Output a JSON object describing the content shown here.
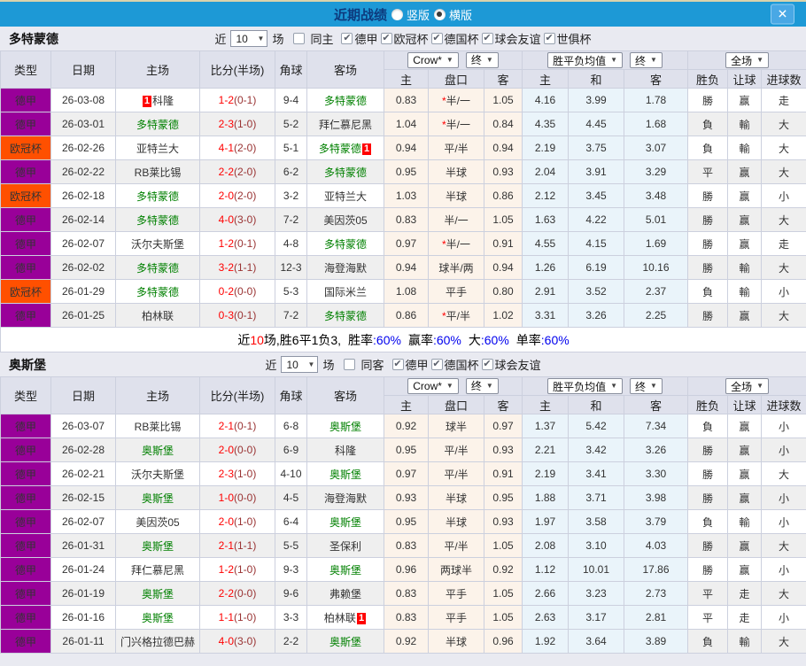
{
  "titlebar": {
    "title": "近期战绩",
    "options": [
      {
        "label": "竖版",
        "selected": false
      },
      {
        "label": "横版",
        "selected": true
      }
    ],
    "close_label": "✕"
  },
  "table_columns": {
    "main": [
      "类型",
      "日期",
      "主场",
      "比分(半场)",
      "角球",
      "客场"
    ],
    "group1_select": "Crow*",
    "group1_final": "终",
    "group2_select": "胜平负均值",
    "group2_final": "终",
    "group3_select": "全场",
    "sub": [
      "主",
      "盘口",
      "客",
      "主",
      "和",
      "客",
      "胜负",
      "让球",
      "进球数"
    ],
    "caret": "▼"
  },
  "colors": {
    "purple": "#990099",
    "orange": "#ff5000",
    "focus_green": "#008000",
    "win_red": "#ff0000",
    "loss_green": "#008000",
    "push_blue": "#0000ee",
    "half_score": "#993333",
    "percent_blue": "#0000ee",
    "titlebar_blue": "#1d99d6"
  },
  "sections": [
    {
      "team": "多特蒙德",
      "filters": {
        "near": "近",
        "count": "10",
        "unit": "场",
        "same": {
          "label": "同主",
          "checked": false
        },
        "leagues": [
          {
            "label": "德甲",
            "checked": true
          },
          {
            "label": "欧冠杯",
            "checked": true
          },
          {
            "label": "德国杯",
            "checked": true
          },
          {
            "label": "球会友谊",
            "checked": true
          },
          {
            "label": "世俱杯",
            "checked": true
          }
        ]
      },
      "rows": [
        {
          "league": "德甲",
          "color": "purple",
          "date": "26-03-08",
          "home": "科隆",
          "home_focus": false,
          "home_badge": true,
          "score": "1-2",
          "half": "(0-1)",
          "corners": "9-4",
          "away": "多特蒙德",
          "away_focus": true,
          "away_badge": false,
          "h_home": "0.83",
          "h_star": true,
          "h_line": "半/一",
          "h_away": "1.05",
          "avg_home": "4.16",
          "avg_draw": "3.99",
          "avg_away": "1.78",
          "r_outcome": "勝",
          "r_handicap": "赢",
          "r_goals": "走"
        },
        {
          "league": "德甲",
          "color": "purple",
          "date": "26-03-01",
          "home": "多特蒙德",
          "home_focus": true,
          "home_badge": false,
          "score": "2-3",
          "half": "(1-0)",
          "corners": "5-2",
          "away": "拜仁慕尼黑",
          "away_focus": false,
          "away_badge": false,
          "h_home": "1.04",
          "h_star": true,
          "h_line": "半/一",
          "h_away": "0.84",
          "avg_home": "4.35",
          "avg_draw": "4.45",
          "avg_away": "1.68",
          "r_outcome": "負",
          "r_handicap": "輸",
          "r_goals": "大"
        },
        {
          "league": "欧冠杯",
          "color": "orange",
          "date": "26-02-26",
          "home": "亚特兰大",
          "home_focus": false,
          "home_badge": false,
          "score": "4-1",
          "half": "(2-0)",
          "corners": "5-1",
          "away": "多特蒙德",
          "away_focus": true,
          "away_badge": true,
          "h_home": "0.94",
          "h_star": false,
          "h_line": "平/半",
          "h_away": "0.94",
          "avg_home": "2.19",
          "avg_draw": "3.75",
          "avg_away": "3.07",
          "r_outcome": "負",
          "r_handicap": "輸",
          "r_goals": "大"
        },
        {
          "league": "德甲",
          "color": "purple",
          "date": "26-02-22",
          "home": "RB莱比锡",
          "home_focus": false,
          "home_badge": false,
          "score": "2-2",
          "half": "(2-0)",
          "corners": "6-2",
          "away": "多特蒙德",
          "away_focus": true,
          "away_badge": false,
          "h_home": "0.95",
          "h_star": false,
          "h_line": "半球",
          "h_away": "0.93",
          "avg_home": "2.04",
          "avg_draw": "3.91",
          "avg_away": "3.29",
          "r_outcome": "平",
          "r_handicap": "赢",
          "r_goals": "大"
        },
        {
          "league": "欧冠杯",
          "color": "orange",
          "date": "26-02-18",
          "home": "多特蒙德",
          "home_focus": true,
          "home_badge": false,
          "score": "2-0",
          "half": "(2-0)",
          "corners": "3-2",
          "away": "亚特兰大",
          "away_focus": false,
          "away_badge": false,
          "h_home": "1.03",
          "h_star": false,
          "h_line": "半球",
          "h_away": "0.86",
          "avg_home": "2.12",
          "avg_draw": "3.45",
          "avg_away": "3.48",
          "r_outcome": "勝",
          "r_handicap": "赢",
          "r_goals": "小"
        },
        {
          "league": "德甲",
          "color": "purple",
          "date": "26-02-14",
          "home": "多特蒙德",
          "home_focus": true,
          "home_badge": false,
          "score": "4-0",
          "half": "(3-0)",
          "corners": "7-2",
          "away": "美因茨05",
          "away_focus": false,
          "away_badge": false,
          "h_home": "0.83",
          "h_star": false,
          "h_line": "半/一",
          "h_away": "1.05",
          "avg_home": "1.63",
          "avg_draw": "4.22",
          "avg_away": "5.01",
          "r_outcome": "勝",
          "r_handicap": "赢",
          "r_goals": "大"
        },
        {
          "league": "德甲",
          "color": "purple",
          "date": "26-02-07",
          "home": "沃尔夫斯堡",
          "home_focus": false,
          "home_badge": false,
          "score": "1-2",
          "half": "(0-1)",
          "corners": "4-8",
          "away": "多特蒙德",
          "away_focus": true,
          "away_badge": false,
          "h_home": "0.97",
          "h_star": true,
          "h_line": "半/一",
          "h_away": "0.91",
          "avg_home": "4.55",
          "avg_draw": "4.15",
          "avg_away": "1.69",
          "r_outcome": "勝",
          "r_handicap": "赢",
          "r_goals": "走"
        },
        {
          "league": "德甲",
          "color": "purple",
          "date": "26-02-02",
          "home": "多特蒙德",
          "home_focus": true,
          "home_badge": false,
          "score": "3-2",
          "half": "(1-1)",
          "corners": "12-3",
          "away": "海登海默",
          "away_focus": false,
          "away_badge": false,
          "h_home": "0.94",
          "h_star": false,
          "h_line": "球半/两",
          "h_away": "0.94",
          "avg_home": "1.26",
          "avg_draw": "6.19",
          "avg_away": "10.16",
          "r_outcome": "勝",
          "r_handicap": "輸",
          "r_goals": "大"
        },
        {
          "league": "欧冠杯",
          "color": "orange",
          "date": "26-01-29",
          "home": "多特蒙德",
          "home_focus": true,
          "home_badge": false,
          "score": "0-2",
          "half": "(0-0)",
          "corners": "5-3",
          "away": "国际米兰",
          "away_focus": false,
          "away_badge": false,
          "h_home": "1.08",
          "h_star": false,
          "h_line": "平手",
          "h_away": "0.80",
          "avg_home": "2.91",
          "avg_draw": "3.52",
          "avg_away": "2.37",
          "r_outcome": "負",
          "r_handicap": "輸",
          "r_goals": "小"
        },
        {
          "league": "德甲",
          "color": "purple",
          "date": "26-01-25",
          "home": "柏林联",
          "home_focus": false,
          "home_badge": false,
          "score": "0-3",
          "half": "(0-1)",
          "corners": "7-2",
          "away": "多特蒙德",
          "away_focus": true,
          "away_badge": false,
          "h_home": "0.86",
          "h_star": true,
          "h_line": "平/半",
          "h_away": "1.02",
          "avg_home": "3.31",
          "avg_draw": "3.26",
          "avg_away": "2.25",
          "r_outcome": "勝",
          "r_handicap": "赢",
          "r_goals": "大"
        }
      ],
      "summary": {
        "pre": "近",
        "count": "10",
        "mid": "场,胜6平1负3,",
        "stats": [
          {
            "label": "胜率",
            "value": "60%"
          },
          {
            "label": "赢率",
            "value": "60%"
          },
          {
            "label": "大",
            "value": "60%"
          },
          {
            "label": "单率",
            "value": "60%"
          }
        ]
      }
    },
    {
      "team": "奥斯堡",
      "filters": {
        "near": "近",
        "count": "10",
        "unit": "场",
        "same": {
          "label": "同客",
          "checked": false
        },
        "leagues": [
          {
            "label": "德甲",
            "checked": true
          },
          {
            "label": "德国杯",
            "checked": true
          },
          {
            "label": "球会友谊",
            "checked": true
          }
        ]
      },
      "rows": [
        {
          "league": "德甲",
          "color": "purple",
          "date": "26-03-07",
          "home": "RB莱比锡",
          "home_focus": false,
          "home_badge": false,
          "score": "2-1",
          "half": "(0-1)",
          "corners": "6-8",
          "away": "奥斯堡",
          "away_focus": true,
          "away_badge": false,
          "h_home": "0.92",
          "h_star": false,
          "h_line": "球半",
          "h_away": "0.97",
          "avg_home": "1.37",
          "avg_draw": "5.42",
          "avg_away": "7.34",
          "r_outcome": "負",
          "r_handicap": "赢",
          "r_goals": "小"
        },
        {
          "league": "德甲",
          "color": "purple",
          "date": "26-02-28",
          "home": "奥斯堡",
          "home_focus": true,
          "home_badge": false,
          "score": "2-0",
          "half": "(0-0)",
          "corners": "6-9",
          "away": "科隆",
          "away_focus": false,
          "away_badge": false,
          "h_home": "0.95",
          "h_star": false,
          "h_line": "平/半",
          "h_away": "0.93",
          "avg_home": "2.21",
          "avg_draw": "3.42",
          "avg_away": "3.26",
          "r_outcome": "勝",
          "r_handicap": "赢",
          "r_goals": "小"
        },
        {
          "league": "德甲",
          "color": "purple",
          "date": "26-02-21",
          "home": "沃尔夫斯堡",
          "home_focus": false,
          "home_badge": false,
          "score": "2-3",
          "half": "(1-0)",
          "corners": "4-10",
          "away": "奥斯堡",
          "away_focus": true,
          "away_badge": false,
          "h_home": "0.97",
          "h_star": false,
          "h_line": "平/半",
          "h_away": "0.91",
          "avg_home": "2.19",
          "avg_draw": "3.41",
          "avg_away": "3.30",
          "r_outcome": "勝",
          "r_handicap": "赢",
          "r_goals": "大"
        },
        {
          "league": "德甲",
          "color": "purple",
          "date": "26-02-15",
          "home": "奥斯堡",
          "home_focus": true,
          "home_badge": false,
          "score": "1-0",
          "half": "(0-0)",
          "corners": "4-5",
          "away": "海登海默",
          "away_focus": false,
          "away_badge": false,
          "h_home": "0.93",
          "h_star": false,
          "h_line": "半球",
          "h_away": "0.95",
          "avg_home": "1.88",
          "avg_draw": "3.71",
          "avg_away": "3.98",
          "r_outcome": "勝",
          "r_handicap": "赢",
          "r_goals": "小"
        },
        {
          "league": "德甲",
          "color": "purple",
          "date": "26-02-07",
          "home": "美因茨05",
          "home_focus": false,
          "home_badge": false,
          "score": "2-0",
          "half": "(1-0)",
          "corners": "6-4",
          "away": "奥斯堡",
          "away_focus": true,
          "away_badge": false,
          "h_home": "0.95",
          "h_star": false,
          "h_line": "半球",
          "h_away": "0.93",
          "avg_home": "1.97",
          "avg_draw": "3.58",
          "avg_away": "3.79",
          "r_outcome": "負",
          "r_handicap": "輸",
          "r_goals": "小"
        },
        {
          "league": "德甲",
          "color": "purple",
          "date": "26-01-31",
          "home": "奥斯堡",
          "home_focus": true,
          "home_badge": false,
          "score": "2-1",
          "half": "(1-1)",
          "corners": "5-5",
          "away": "圣保利",
          "away_focus": false,
          "away_badge": false,
          "h_home": "0.83",
          "h_star": false,
          "h_line": "平/半",
          "h_away": "1.05",
          "avg_home": "2.08",
          "avg_draw": "3.10",
          "avg_away": "4.03",
          "r_outcome": "勝",
          "r_handicap": "赢",
          "r_goals": "大"
        },
        {
          "league": "德甲",
          "color": "purple",
          "date": "26-01-24",
          "home": "拜仁慕尼黑",
          "home_focus": false,
          "home_badge": false,
          "score": "1-2",
          "half": "(1-0)",
          "corners": "9-3",
          "away": "奥斯堡",
          "away_focus": true,
          "away_badge": false,
          "h_home": "0.96",
          "h_star": false,
          "h_line": "两球半",
          "h_away": "0.92",
          "avg_home": "1.12",
          "avg_draw": "10.01",
          "avg_away": "17.86",
          "r_outcome": "勝",
          "r_handicap": "赢",
          "r_goals": "小"
        },
        {
          "league": "德甲",
          "color": "purple",
          "date": "26-01-19",
          "home": "奥斯堡",
          "home_focus": true,
          "home_badge": false,
          "score": "2-2",
          "half": "(0-0)",
          "corners": "9-6",
          "away": "弗赖堡",
          "away_focus": false,
          "away_badge": false,
          "h_home": "0.83",
          "h_star": false,
          "h_line": "平手",
          "h_away": "1.05",
          "avg_home": "2.66",
          "avg_draw": "3.23",
          "avg_away": "2.73",
          "r_outcome": "平",
          "r_handicap": "走",
          "r_goals": "大"
        },
        {
          "league": "德甲",
          "color": "purple",
          "date": "26-01-16",
          "home": "奥斯堡",
          "home_focus": true,
          "home_badge": false,
          "score": "1-1",
          "half": "(1-0)",
          "corners": "3-3",
          "away": "柏林联",
          "away_focus": false,
          "away_badge": true,
          "h_home": "0.83",
          "h_star": false,
          "h_line": "平手",
          "h_away": "1.05",
          "avg_home": "2.63",
          "avg_draw": "3.17",
          "avg_away": "2.81",
          "r_outcome": "平",
          "r_handicap": "走",
          "r_goals": "小"
        },
        {
          "league": "德甲",
          "color": "purple",
          "date": "26-01-11",
          "home": "门兴格拉德巴赫",
          "home_focus": false,
          "home_badge": false,
          "score": "4-0",
          "half": "(3-0)",
          "corners": "2-2",
          "away": "奥斯堡",
          "away_focus": true,
          "away_badge": false,
          "h_home": "0.92",
          "h_star": false,
          "h_line": "半球",
          "h_away": "0.96",
          "avg_home": "1.92",
          "avg_draw": "3.64",
          "avg_away": "3.89",
          "r_outcome": "負",
          "r_handicap": "輸",
          "r_goals": "大"
        }
      ],
      "summary": null
    }
  ]
}
